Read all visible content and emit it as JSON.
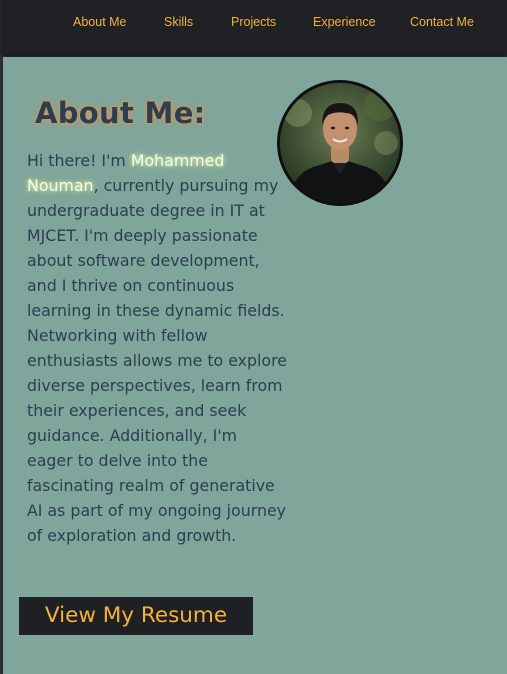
{
  "nav": {
    "items": [
      {
        "label": "About Me"
      },
      {
        "label": "Skills"
      },
      {
        "label": "Projects"
      },
      {
        "label": "Experience"
      },
      {
        "label": "Contact Me"
      }
    ]
  },
  "about": {
    "heading": "About Me:",
    "bio_greeting": "Hi there! I'm ",
    "name": "Mohammed Nouman",
    "bio_text": ", currently pursuing my undergraduate degree in IT at MJCET. I'm deeply passionate about software development, and I thrive on continuous learning in these dynamic fields. Networking with fellow enthusiasts allows me to explore diverse perspectives, learn from their experiences, and seek guidance. Additionally, I'm eager to delve into the fascinating realm of generative AI as part of my ongoing journey of exploration and growth."
  },
  "resume": {
    "button_label": "View My Resume"
  },
  "colors": {
    "accent": "#f4b23c",
    "navbar_bg": "#1f2124",
    "page_bg": "#80a59a",
    "text": "#2c3e50"
  }
}
